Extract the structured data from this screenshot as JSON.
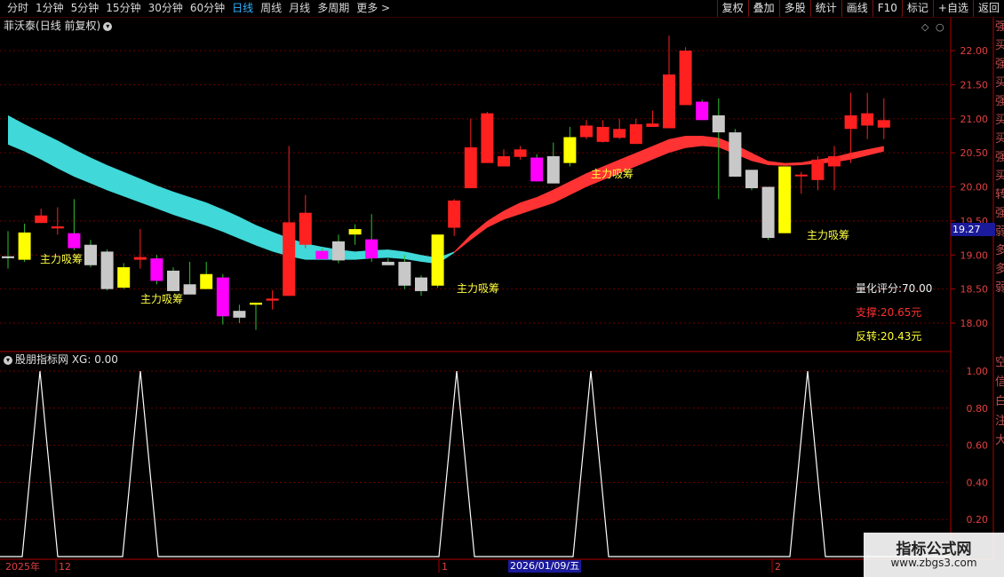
{
  "toolbar": {
    "periods": [
      "分时",
      "1分钟",
      "5分钟",
      "15分钟",
      "30分钟",
      "60分钟",
      "日线",
      "周线",
      "月线",
      "多周期",
      "更多 >"
    ],
    "active_index": 6,
    "right_buttons": [
      "复权",
      "叠加",
      "多股",
      "统计",
      "画线",
      "F10",
      "标记",
      "+自选",
      "返回"
    ]
  },
  "title": {
    "stock": "菲沃泰",
    "mode": "(日线 前复权)"
  },
  "price_axis": [
    "22.00",
    "21.50",
    "21.00",
    "20.50",
    "20.00",
    "19.50",
    "19.00",
    "18.50",
    "18.00"
  ],
  "current_price": "19.27",
  "labels": {
    "zhuli": "主力吸筹"
  },
  "info": {
    "score": "量化评分:70.00",
    "support": "支撑:20.65元",
    "reversal": "反转:20.43元"
  },
  "indicator": {
    "title": "股朋指标网 XG: 0.00",
    "axis": [
      "1.00",
      "0.80",
      "0.60",
      "0.40",
      "0.20"
    ]
  },
  "date_axis": {
    "year": "2025年",
    "ticks": [
      "12",
      "1",
      "2"
    ],
    "selected": "2026/01/09/五"
  },
  "watermark": {
    "line1": "指标公式网",
    "line2": "www.zbgs3.com"
  },
  "right_panel_chars": [
    "强",
    "买",
    "强",
    "买",
    "强",
    "买",
    "买",
    "强",
    "买",
    "转",
    "强",
    "弱",
    "多",
    "多",
    "弱",
    "空",
    "信",
    "白",
    "注",
    "大"
  ],
  "colors": {
    "up": "#ff2020",
    "down": "#c8c8c8",
    "yellow": "#ffff00",
    "magenta": "#ff00ff",
    "cyan": "#40d8d8",
    "ribbon_red": "#ff3333",
    "grid": "#5a0000"
  },
  "chart_data": {
    "type": "candlestick",
    "candles": [
      {
        "o": 18.98,
        "h": 19.35,
        "l": 18.8,
        "c": 18.98,
        "col": "white"
      },
      {
        "o": 18.93,
        "h": 19.46,
        "l": 18.9,
        "c": 19.33,
        "col": "yellow"
      },
      {
        "o": 19.58,
        "h": 19.68,
        "l": 19.47,
        "c": 19.47,
        "col": "red"
      },
      {
        "o": 19.42,
        "h": 19.7,
        "l": 19.3,
        "c": 19.39,
        "col": "red"
      },
      {
        "o": 19.32,
        "h": 19.82,
        "l": 19.07,
        "c": 19.1,
        "col": "magenta"
      },
      {
        "o": 19.15,
        "h": 19.22,
        "l": 18.82,
        "c": 18.85,
        "col": "grey"
      },
      {
        "o": 19.05,
        "h": 19.08,
        "l": 18.48,
        "c": 18.5,
        "col": "grey"
      },
      {
        "o": 18.82,
        "h": 18.88,
        "l": 18.5,
        "c": 18.52,
        "col": "yellow"
      },
      {
        "o": 18.97,
        "h": 19.38,
        "l": 18.8,
        "c": 18.93,
        "col": "red"
      },
      {
        "o": 18.95,
        "h": 19.0,
        "l": 18.57,
        "c": 18.62,
        "col": "magenta"
      },
      {
        "o": 18.77,
        "h": 18.82,
        "l": 18.47,
        "c": 18.47,
        "col": "grey"
      },
      {
        "o": 18.57,
        "h": 18.9,
        "l": 18.45,
        "c": 18.42,
        "col": "grey"
      },
      {
        "o": 18.72,
        "h": 18.9,
        "l": 18.5,
        "c": 18.5,
        "col": "yellow"
      },
      {
        "o": 18.67,
        "h": 18.72,
        "l": 17.98,
        "c": 18.1,
        "col": "magenta"
      },
      {
        "o": 18.18,
        "h": 18.27,
        "l": 18.0,
        "c": 18.08,
        "col": "grey"
      },
      {
        "o": 18.27,
        "h": 18.3,
        "l": 17.9,
        "c": 18.3,
        "col": "yellow"
      },
      {
        "o": 18.36,
        "h": 18.48,
        "l": 18.2,
        "c": 18.33,
        "col": "red"
      },
      {
        "o": 18.4,
        "h": 20.6,
        "l": 18.4,
        "c": 19.48,
        "col": "red"
      },
      {
        "o": 19.15,
        "h": 19.88,
        "l": 19.1,
        "c": 19.62,
        "col": "red"
      },
      {
        "o": 19.06,
        "h": 19.1,
        "l": 18.94,
        "c": 18.94,
        "col": "magenta"
      },
      {
        "o": 19.2,
        "h": 19.3,
        "l": 18.88,
        "c": 18.92,
        "col": "grey"
      },
      {
        "o": 19.3,
        "h": 19.45,
        "l": 19.15,
        "c": 19.38,
        "col": "yellow"
      },
      {
        "o": 19.23,
        "h": 19.6,
        "l": 18.9,
        "c": 18.95,
        "col": "magenta"
      },
      {
        "o": 18.9,
        "h": 18.95,
        "l": 18.85,
        "c": 18.85,
        "col": "grey"
      },
      {
        "o": 18.9,
        "h": 19.0,
        "l": 18.5,
        "c": 18.55,
        "col": "grey"
      },
      {
        "o": 18.67,
        "h": 18.7,
        "l": 18.4,
        "c": 18.47,
        "col": "grey"
      },
      {
        "o": 18.55,
        "h": 19.3,
        "l": 18.52,
        "c": 19.3,
        "col": "yellow"
      },
      {
        "o": 19.8,
        "h": 19.82,
        "l": 19.28,
        "c": 19.4,
        "col": "red"
      },
      {
        "o": 20.58,
        "h": 21.0,
        "l": 19.98,
        "c": 19.98,
        "col": "red"
      },
      {
        "o": 21.08,
        "h": 21.1,
        "l": 20.35,
        "c": 20.35,
        "col": "red"
      },
      {
        "o": 20.45,
        "h": 20.55,
        "l": 20.3,
        "c": 20.3,
        "col": "red"
      },
      {
        "o": 20.55,
        "h": 20.6,
        "l": 20.4,
        "c": 20.44,
        "col": "red"
      },
      {
        "o": 20.43,
        "h": 20.48,
        "l": 20.08,
        "c": 20.08,
        "col": "magenta"
      },
      {
        "o": 20.45,
        "h": 20.65,
        "l": 20.05,
        "c": 20.05,
        "col": "grey"
      },
      {
        "o": 20.35,
        "h": 20.88,
        "l": 20.3,
        "c": 20.73,
        "col": "yellow"
      },
      {
        "o": 20.9,
        "h": 20.98,
        "l": 20.7,
        "c": 20.73,
        "col": "red"
      },
      {
        "o": 20.88,
        "h": 20.98,
        "l": 20.65,
        "c": 20.66,
        "col": "red"
      },
      {
        "o": 20.85,
        "h": 21.0,
        "l": 20.7,
        "c": 20.72,
        "col": "red"
      },
      {
        "o": 20.92,
        "h": 21.0,
        "l": 20.63,
        "c": 20.63,
        "col": "red"
      },
      {
        "o": 20.93,
        "h": 21.12,
        "l": 20.88,
        "c": 20.88,
        "col": "red"
      },
      {
        "o": 21.65,
        "h": 22.22,
        "l": 20.86,
        "c": 20.86,
        "col": "red"
      },
      {
        "o": 22.0,
        "h": 22.05,
        "l": 21.2,
        "c": 21.2,
        "col": "red"
      },
      {
        "o": 21.25,
        "h": 21.28,
        "l": 20.98,
        "c": 20.98,
        "col": "magenta"
      },
      {
        "o": 21.05,
        "h": 21.3,
        "l": 19.82,
        "c": 20.8,
        "col": "grey"
      },
      {
        "o": 20.8,
        "h": 20.85,
        "l": 20.15,
        "c": 20.15,
        "col": "grey"
      },
      {
        "o": 20.25,
        "h": 20.25,
        "l": 19.95,
        "c": 19.98,
        "col": "grey"
      },
      {
        "o": 20.0,
        "h": 20.0,
        "l": 19.22,
        "c": 19.25,
        "col": "grey"
      },
      {
        "o": 19.32,
        "h": 20.25,
        "l": 19.32,
        "c": 20.3,
        "col": "yellow"
      },
      {
        "o": 20.18,
        "h": 20.22,
        "l": 19.9,
        "c": 20.18,
        "col": "red"
      },
      {
        "o": 20.4,
        "h": 20.45,
        "l": 19.95,
        "c": 20.1,
        "col": "red"
      },
      {
        "o": 20.45,
        "h": 20.6,
        "l": 19.95,
        "c": 20.3,
        "col": "red"
      },
      {
        "o": 21.05,
        "h": 21.38,
        "l": 20.35,
        "c": 20.85,
        "col": "red"
      },
      {
        "o": 21.08,
        "h": 21.38,
        "l": 20.7,
        "c": 20.9,
        "col": "red"
      },
      {
        "o": 20.98,
        "h": 21.3,
        "l": 20.7,
        "c": 20.87,
        "col": "red"
      }
    ],
    "ribbon_ylim": [
      17.8,
      22.3
    ],
    "indicator_peaks": [
      2,
      8,
      27,
      35,
      48
    ],
    "indicator_ylim": [
      0,
      1.05
    ]
  }
}
